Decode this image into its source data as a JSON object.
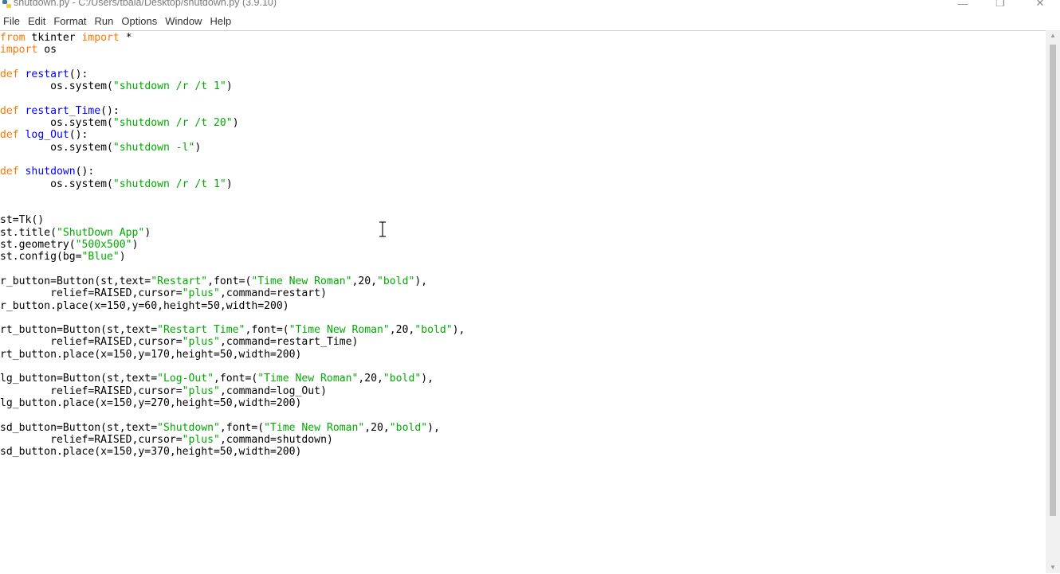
{
  "window": {
    "title": "shutdown.py - C:/Users/tbala/Desktop/shutdown.py (3.9.10)",
    "controls": {
      "minimize": "—",
      "maximize": "❐",
      "close": "✕"
    }
  },
  "menu": {
    "items": [
      "File",
      "Edit",
      "Format",
      "Run",
      "Options",
      "Window",
      "Help"
    ]
  },
  "colors": {
    "keyword": "#ff7700",
    "definition": "#0000ff",
    "string": "#00aa00",
    "default": "#000000"
  },
  "editor": {
    "lines": [
      [
        [
          "kw",
          "from"
        ],
        [
          "t",
          " tkinter "
        ],
        [
          "kw",
          "import"
        ],
        [
          "t",
          " *"
        ]
      ],
      [
        [
          "kw",
          "import"
        ],
        [
          "t",
          " os"
        ]
      ],
      [],
      [
        [
          "kw",
          "def"
        ],
        [
          "t",
          " "
        ],
        [
          "def",
          "restart"
        ],
        [
          "t",
          "():"
        ]
      ],
      [
        [
          "t",
          "        os.system("
        ],
        [
          "str",
          "\"shutdown /r /t 1\""
        ],
        [
          "t",
          ")"
        ]
      ],
      [],
      [
        [
          "kw",
          "def"
        ],
        [
          "t",
          " "
        ],
        [
          "def",
          "restart_Time"
        ],
        [
          "t",
          "():"
        ]
      ],
      [
        [
          "t",
          "        os.system("
        ],
        [
          "str",
          "\"shutdown /r /t 20\""
        ],
        [
          "t",
          ")"
        ]
      ],
      [
        [
          "kw",
          "def"
        ],
        [
          "t",
          " "
        ],
        [
          "def",
          "log_Out"
        ],
        [
          "t",
          "():"
        ]
      ],
      [
        [
          "t",
          "        os.system("
        ],
        [
          "str",
          "\"shutdown -l\""
        ],
        [
          "t",
          ")"
        ]
      ],
      [],
      [
        [
          "kw",
          "def"
        ],
        [
          "t",
          " "
        ],
        [
          "def",
          "shutdown"
        ],
        [
          "t",
          "():"
        ]
      ],
      [
        [
          "t",
          "        os.system("
        ],
        [
          "str",
          "\"shutdown /r /t 1\""
        ],
        [
          "t",
          ")"
        ]
      ],
      [],
      [],
      [
        [
          "t",
          "st=Tk()"
        ]
      ],
      [
        [
          "t",
          "st.title("
        ],
        [
          "str",
          "\"ShutDown App\""
        ],
        [
          "t",
          ")"
        ]
      ],
      [
        [
          "t",
          "st.geometry("
        ],
        [
          "str",
          "\"500x500\""
        ],
        [
          "t",
          ")"
        ]
      ],
      [
        [
          "t",
          "st.config(bg="
        ],
        [
          "str",
          "\"Blue\""
        ],
        [
          "t",
          ")"
        ]
      ],
      [],
      [
        [
          "t",
          "r_button=Button(st,text="
        ],
        [
          "str",
          "\"Restart\""
        ],
        [
          "t",
          ",font=("
        ],
        [
          "str",
          "\"Time New Roman\""
        ],
        [
          "t",
          ",20,"
        ],
        [
          "str",
          "\"bold\""
        ],
        [
          "t",
          "),"
        ]
      ],
      [
        [
          "t",
          "        relief=RAISED,cursor="
        ],
        [
          "str",
          "\"plus\""
        ],
        [
          "t",
          ",command=restart)"
        ]
      ],
      [
        [
          "t",
          "r_button.place(x=150,y=60,height=50,width=200)"
        ]
      ],
      [],
      [
        [
          "t",
          "rt_button=Button(st,text="
        ],
        [
          "str",
          "\"Restart Time\""
        ],
        [
          "t",
          ",font=("
        ],
        [
          "str",
          "\"Time New Roman\""
        ],
        [
          "t",
          ",20,"
        ],
        [
          "str",
          "\"bold\""
        ],
        [
          "t",
          "),"
        ]
      ],
      [
        [
          "t",
          "        relief=RAISED,cursor="
        ],
        [
          "str",
          "\"plus\""
        ],
        [
          "t",
          ",command=restart_Time)"
        ]
      ],
      [
        [
          "t",
          "rt_button.place(x=150,y=170,height=50,width=200)"
        ]
      ],
      [],
      [
        [
          "t",
          "lg_button=Button(st,text="
        ],
        [
          "str",
          "\"Log-Out\""
        ],
        [
          "t",
          ",font=("
        ],
        [
          "str",
          "\"Time New Roman\""
        ],
        [
          "t",
          ",20,"
        ],
        [
          "str",
          "\"bold\""
        ],
        [
          "t",
          "),"
        ]
      ],
      [
        [
          "t",
          "        relief=RAISED,cursor="
        ],
        [
          "str",
          "\"plus\""
        ],
        [
          "t",
          ",command=log_Out)"
        ]
      ],
      [
        [
          "t",
          "lg_button.place(x=150,y=270,height=50,width=200)"
        ]
      ],
      [],
      [
        [
          "t",
          "sd_button=Button(st,text="
        ],
        [
          "str",
          "\"Shutdown\""
        ],
        [
          "t",
          ",font=("
        ],
        [
          "str",
          "\"Time New Roman\""
        ],
        [
          "t",
          ",20,"
        ],
        [
          "str",
          "\"bold\""
        ],
        [
          "t",
          "),"
        ]
      ],
      [
        [
          "t",
          "        relief=RAISED,cursor="
        ],
        [
          "str",
          "\"plus\""
        ],
        [
          "t",
          ",command=shutdown)"
        ]
      ],
      [
        [
          "t",
          "sd_button.place(x=150,y=370,height=50,width=200)"
        ]
      ]
    ]
  }
}
